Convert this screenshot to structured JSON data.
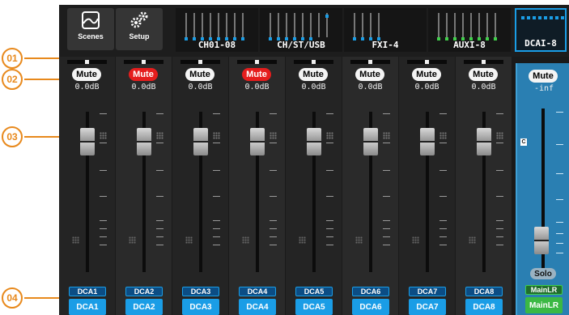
{
  "callouts": [
    "01",
    "02",
    "03",
    "04"
  ],
  "topbar": {
    "scenes_label": "Scenes",
    "setup_label": "Setup",
    "banks": [
      "CH01-08",
      "CH/ST/USB",
      "FXI-4",
      "AUXI-8",
      "DCAI-8"
    ],
    "active_bank": "DCAI-8"
  },
  "strips": [
    {
      "mute": "Mute",
      "gain": "0.0dB",
      "dca_top": "DCA1",
      "dca_bottom": "DCA1",
      "muted": false
    },
    {
      "mute": "Mute",
      "gain": "0.0dB",
      "dca_top": "DCA2",
      "dca_bottom": "DCA2",
      "muted": true
    },
    {
      "mute": "Mute",
      "gain": "0.0dB",
      "dca_top": "DCA3",
      "dca_bottom": "DCA3",
      "muted": false
    },
    {
      "mute": "Mute",
      "gain": "0.0dB",
      "dca_top": "DCA4",
      "dca_bottom": "DCA4",
      "muted": true
    },
    {
      "mute": "Mute",
      "gain": "0.0dB",
      "dca_top": "DCA5",
      "dca_bottom": "DCA5",
      "muted": false
    },
    {
      "mute": "Mute",
      "gain": "0.0dB",
      "dca_top": "DCA6",
      "dca_bottom": "DCA6",
      "muted": false
    },
    {
      "mute": "Mute",
      "gain": "0.0dB",
      "dca_top": "DCA7",
      "dca_bottom": "DCA7",
      "muted": false
    },
    {
      "mute": "Mute",
      "gain": "0.0dB",
      "dca_top": "DCA8",
      "dca_bottom": "DCA8",
      "muted": false
    }
  ],
  "master": {
    "mute": "Mute",
    "gain": "-inf",
    "c_label": "C",
    "solo": "Solo",
    "out_top": "MainLR",
    "out_bottom": "MainLR"
  },
  "colors": {
    "accent": "#1a9de6",
    "mute_on": "#e51d1d",
    "master_bg": "#2a7fb2",
    "callout": "#e8891c"
  }
}
